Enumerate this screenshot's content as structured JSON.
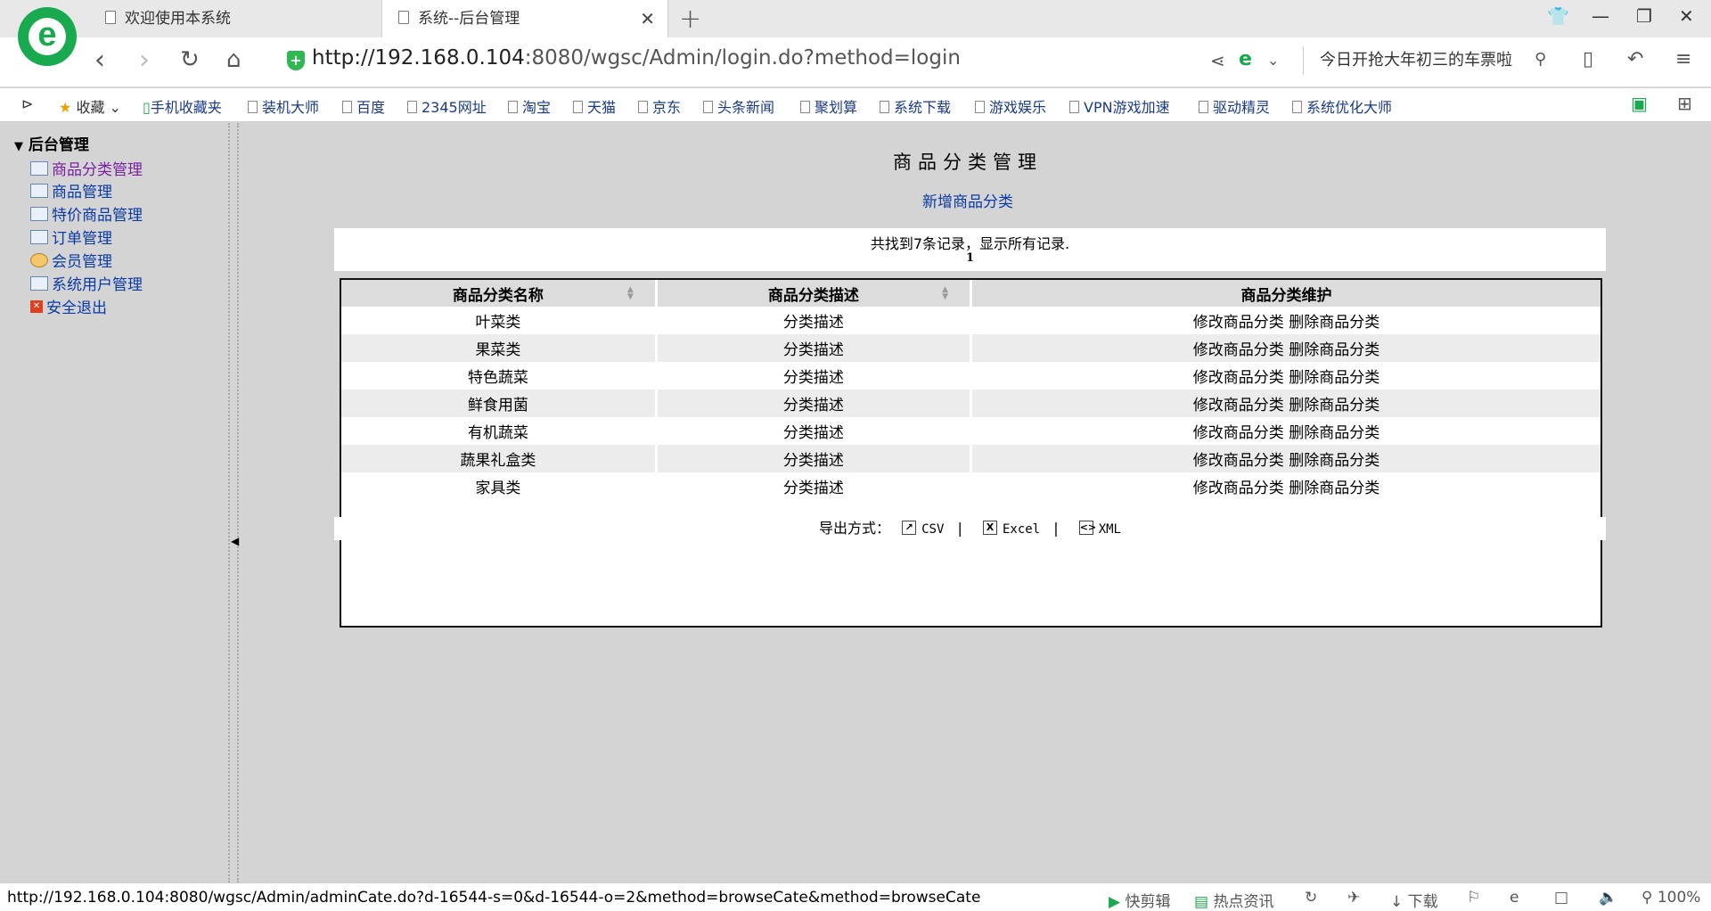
{
  "browser": {
    "tabs": [
      {
        "title": "欢迎使用本系统"
      },
      {
        "title": "系统--后台管理"
      }
    ],
    "url": "http://192.168.0.104:8080/wgsc/Admin/login.do?method=login",
    "url_host": "http://192.168.0.104",
    "url_rest": ":8080/wgsc/Admin/login.do?method=login",
    "search_text": "今日开抢大年初三的车票啦",
    "bookmarks_label": "收藏",
    "bookmarks": [
      "手机收藏夹",
      "装机大师",
      "百度",
      "2345网址",
      "淘宝",
      "天猫",
      "京东",
      "头条新闻",
      "聚划算",
      "系统下载",
      "游戏娱乐",
      "VPN游戏加速",
      "驱动精灵",
      "系统优化大师"
    ]
  },
  "sidebar": {
    "root": "后台管理",
    "items": [
      {
        "label": "商品分类管理",
        "color": "#7a1fa2"
      },
      {
        "label": "商品管理",
        "color": "#0a3aa8"
      },
      {
        "label": "特价商品管理",
        "color": "#0a3aa8"
      },
      {
        "label": "订单管理",
        "color": "#0a3aa8"
      },
      {
        "label": "会员管理",
        "color": "#0a3aa8"
      },
      {
        "label": "系统用户管理",
        "color": "#0a3aa8"
      },
      {
        "label": "安全退出",
        "color": "#0a3aa8"
      }
    ]
  },
  "main": {
    "title": "商品分类管理",
    "add_link": "新增商品分类",
    "pager_text": "共找到7条记录，显示所有记录.",
    "pager_page": "1",
    "columns": [
      "商品分类名称",
      "商品分类描述",
      "商品分类维护"
    ],
    "rows": [
      {
        "name": "叶菜类",
        "desc": "分类描述"
      },
      {
        "name": "果菜类",
        "desc": "分类描述"
      },
      {
        "name": "特色蔬菜",
        "desc": "分类描述"
      },
      {
        "name": "鲜食用菌",
        "desc": "分类描述"
      },
      {
        "name": "有机蔬菜",
        "desc": "分类描述"
      },
      {
        "name": "蔬果礼盒类",
        "desc": "分类描述"
      },
      {
        "name": "家具类",
        "desc": "分类描述"
      }
    ],
    "edit_label": "修改商品分类",
    "delete_label": "删除商品分类",
    "export_label": "导出方式：",
    "export_options": [
      "CSV",
      "Excel",
      "XML"
    ]
  },
  "statusbar": {
    "url": "http://192.168.0.104:8080/wgsc/Admin/adminCate.do?d-16544-s=0&d-16544-o=2&method=browseCate&method=browseCate",
    "clip": "快剪辑",
    "news": "热点资讯",
    "download": "下载",
    "zoom": "100%"
  }
}
